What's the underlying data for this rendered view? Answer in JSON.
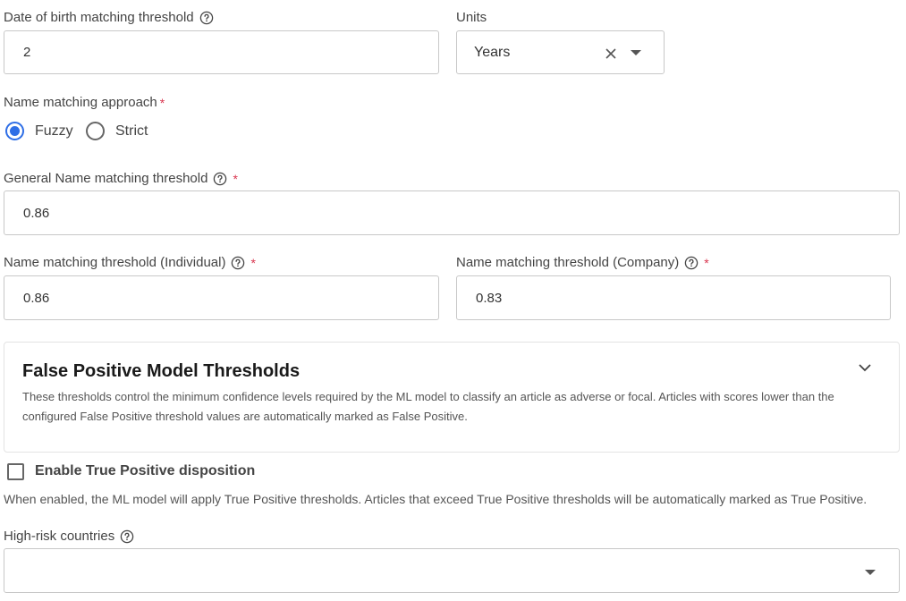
{
  "dob": {
    "label": "Date of birth matching threshold",
    "value": "2"
  },
  "units": {
    "label": "Units",
    "value": "Years"
  },
  "name_approach": {
    "label": "Name matching approach",
    "required_mark": "*",
    "options": [
      {
        "label": "Fuzzy",
        "selected": true
      },
      {
        "label": "Strict",
        "selected": false
      }
    ]
  },
  "general_threshold": {
    "label": "General Name matching threshold",
    "required_mark": "*",
    "value": "0.86"
  },
  "individual_threshold": {
    "label": "Name matching threshold (Individual)",
    "required_mark": "*",
    "value": "0.86"
  },
  "company_threshold": {
    "label": "Name matching threshold (Company)",
    "required_mark": "*",
    "value": "0.83"
  },
  "fp_panel": {
    "title": "False Positive Model Thresholds",
    "description": "These thresholds control the minimum confidence levels required by the ML model to classify an article as adverse or focal. Articles with scores lower than the configured False Positive threshold values are automatically marked as False Positive."
  },
  "tp_disposition": {
    "label": "Enable True Positive disposition",
    "checked": false,
    "description": "When enabled, the ML model will apply True Positive thresholds. Articles that exceed True Positive thresholds will be automatically marked as True Positive."
  },
  "high_risk": {
    "label": "High-risk countries",
    "value": ""
  },
  "colors": {
    "accent": "#2e6ee6",
    "required": "#d9364f",
    "border": "#c8c8c8"
  }
}
